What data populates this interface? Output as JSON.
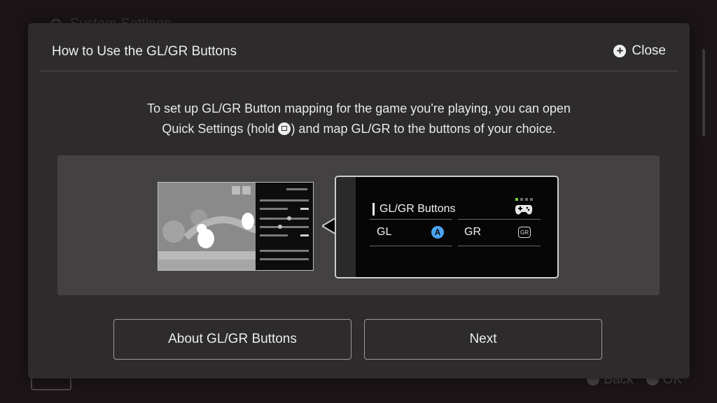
{
  "background": {
    "header_title": "System Settings",
    "footer": {
      "back_label": "Back",
      "ok_label": "OK",
      "back_button_glyph": "B",
      "ok_button_glyph": "A"
    }
  },
  "dialog": {
    "title": "How to Use the GL/GR Buttons",
    "close_label": "Close",
    "close_icon": "plus-circle-icon",
    "description_line1": "To set up GL/GR Button mapping for the game you're playing, you can open",
    "description_line2_before": "Quick Settings (hold ",
    "description_line2_after": ") and map GL/GR to the buttons of your choice.",
    "home_icon": "home-button-icon"
  },
  "illustration": {
    "callout_title": "GL/GR Buttons",
    "gl_label": "GL",
    "gl_mapped_glyph": "A",
    "gr_label": "GR",
    "gr_mapped_glyph": "GR",
    "controller_icon": "controller-icon",
    "colors": {
      "a_button": "#4da3f2",
      "active_dot": "#7ad43c"
    }
  },
  "buttons": {
    "about_label": "About GL/GR Buttons",
    "next_label": "Next"
  }
}
